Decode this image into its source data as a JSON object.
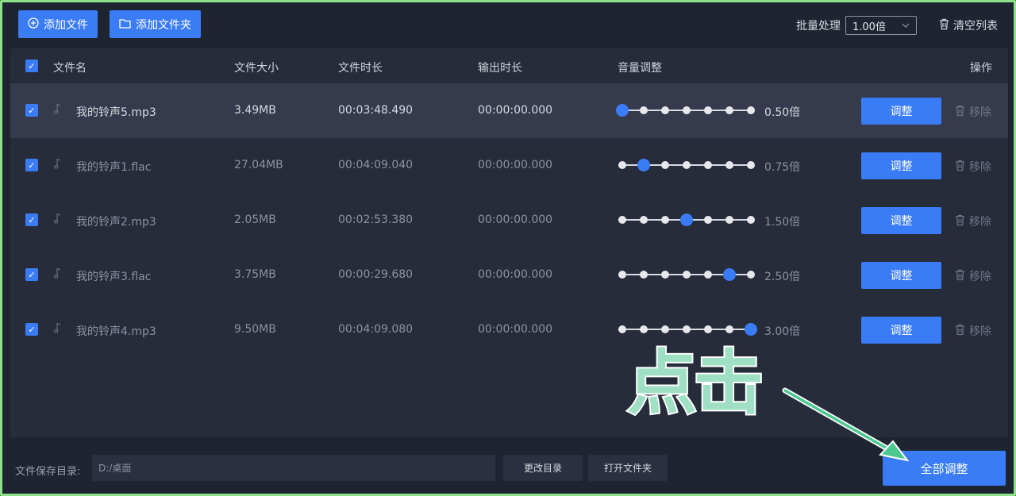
{
  "toolbar": {
    "add_file": "添加文件",
    "add_folder": "添加文件夹",
    "batch_label": "批量处理",
    "batch_value": "1.00倍",
    "clear_list": "清空列表"
  },
  "table": {
    "headers": {
      "name": "文件名",
      "size": "文件大小",
      "duration": "文件时长",
      "output": "输出时长",
      "volume": "音量调整",
      "actions": "操作"
    },
    "rows": [
      {
        "name": "我的铃声5.mp3",
        "size": "3.49MB",
        "duration": "00:03:48.490",
        "output": "00:00:00.000",
        "level": 0,
        "multiplier": "0.50倍",
        "adjust": "调整",
        "remove": "移除"
      },
      {
        "name": "我的铃声1.flac",
        "size": "27.04MB",
        "duration": "00:04:09.040",
        "output": "00:00:00.000",
        "level": 1,
        "multiplier": "0.75倍",
        "adjust": "调整",
        "remove": "移除"
      },
      {
        "name": "我的铃声2.mp3",
        "size": "2.05MB",
        "duration": "00:02:53.380",
        "output": "00:00:00.000",
        "level": 3,
        "multiplier": "1.50倍",
        "adjust": "调整",
        "remove": "移除"
      },
      {
        "name": "我的铃声3.flac",
        "size": "3.75MB",
        "duration": "00:00:29.680",
        "output": "00:00:00.000",
        "level": 5,
        "multiplier": "2.50倍",
        "adjust": "调整",
        "remove": "移除"
      },
      {
        "name": "我的铃声4.mp3",
        "size": "9.50MB",
        "duration": "00:04:09.080",
        "output": "00:00:00.000",
        "level": 6,
        "multiplier": "3.00倍",
        "adjust": "调整",
        "remove": "移除"
      }
    ]
  },
  "footer": {
    "save_label": "文件保存目录:",
    "save_path": "D:/桌面",
    "change_dir": "更改目录",
    "open_folder": "打开文件夹",
    "adjust_all": "全部调整"
  },
  "annotation": {
    "text": "点击"
  },
  "colors": {
    "accent": "#3a7cf5",
    "background": "#1f2431",
    "annotation": "#9fe0c5"
  }
}
